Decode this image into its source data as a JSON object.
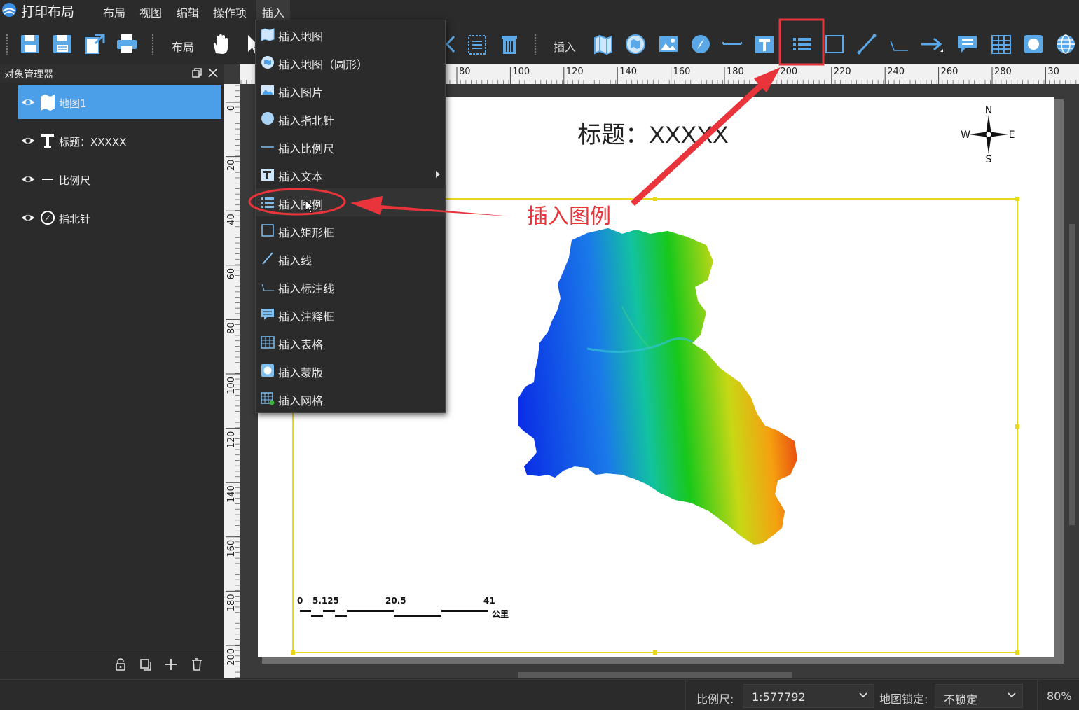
{
  "app": {
    "title": "打印布局"
  },
  "menu": {
    "layout": "布局",
    "view": "视图",
    "edit": "编辑",
    "ops": "操作项",
    "insert": "插入"
  },
  "toolbar": {
    "layout_label": "布局",
    "insert_label": "插入"
  },
  "object_manager": {
    "title": "对象管理器",
    "items": [
      {
        "label": "地图1",
        "icon": "map-icon",
        "selected": true
      },
      {
        "label": "标题：XXXXX",
        "icon": "text-icon",
        "selected": false
      },
      {
        "label": "比例尺",
        "icon": "scalebar-icon",
        "selected": false
      },
      {
        "label": "指北针",
        "icon": "north-arrow-icon",
        "selected": false
      }
    ]
  },
  "ruler": {
    "top_ticks": [
      "80",
      "100",
      "120",
      "140",
      "160",
      "180",
      "200",
      "220",
      "240",
      "260",
      "280",
      "30"
    ],
    "left_ticks": [
      "0",
      "20",
      "40",
      "60",
      "80",
      "100",
      "120",
      "140",
      "160",
      "180",
      "200"
    ]
  },
  "insert_menu": {
    "items": [
      {
        "label": "插入地图",
        "icon": "map-icon"
      },
      {
        "label": "插入地图（圆形）",
        "icon": "circular-map-icon"
      },
      {
        "label": "插入图片",
        "icon": "image-icon"
      },
      {
        "label": "插入指北针",
        "icon": "north-arrow-icon"
      },
      {
        "label": "插入比例尺",
        "icon": "scalebar-icon"
      },
      {
        "label": "插入文本",
        "icon": "text-icon"
      },
      {
        "label": "插入图例",
        "icon": "legend-icon"
      },
      {
        "label": "插入矩形框",
        "icon": "rectangle-icon"
      },
      {
        "label": "插入线",
        "icon": "line-icon"
      },
      {
        "label": "插入标注线",
        "icon": "callout-line-icon"
      },
      {
        "label": "插入注释框",
        "icon": "annotation-box-icon"
      },
      {
        "label": "插入表格",
        "icon": "table-icon"
      },
      {
        "label": "插入蒙版",
        "icon": "mask-icon"
      },
      {
        "label": "插入网格",
        "icon": "grid-icon"
      }
    ]
  },
  "layout_page": {
    "title": "标题：XXXXX",
    "north": {
      "n": "N",
      "s": "S",
      "w": "W",
      "e": "E"
    },
    "scalebar": {
      "labels": [
        "0",
        "5.125",
        "20.5",
        "41"
      ],
      "unit": "公里"
    }
  },
  "annotation": {
    "text": "插入图例",
    "color": "#e8343a"
  },
  "statusbar": {
    "scale_label": "比例尺:",
    "scale_value": "1:577792",
    "lock_label": "地图锁定:",
    "lock_value": "不锁定",
    "zoom": "80%"
  },
  "colors": {
    "accent": "#4a9fe8",
    "selection": "#e8d81c",
    "annotation": "#e8343a"
  }
}
